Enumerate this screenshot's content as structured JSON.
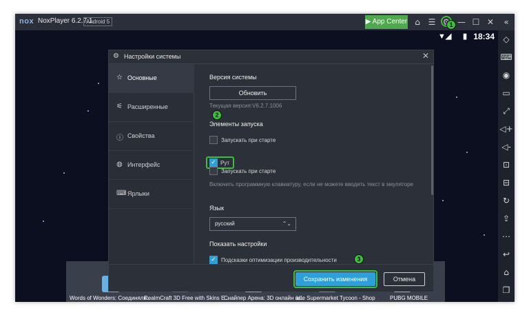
{
  "titlebar": {
    "logo": "nox",
    "app_version": "NoxPlayer 6.2.7.1",
    "android_badge": "Android 5",
    "app_center_label": "App Center"
  },
  "status": {
    "time": "18:34"
  },
  "dialog": {
    "title": "Настройки системы",
    "nav": [
      {
        "label": "Основные",
        "icon": "star-icon"
      },
      {
        "label": "Расширенные",
        "icon": "sliders-icon"
      },
      {
        "label": "Свойства",
        "icon": "info-icon"
      },
      {
        "label": "Интерфейс",
        "icon": "palette-icon"
      },
      {
        "label": "Ярлыки",
        "icon": "keyboard-icon"
      }
    ],
    "content": {
      "system_version_heading": "Версия системы",
      "update_button": "Обновить",
      "current_version": "Текущая версия:V6.2.7.1006",
      "startup_heading": "Элементы запуска",
      "checkbox_startup": "Запускать при старте",
      "checkbox_root": "Рут",
      "checkbox_startup2": "Запускать при старте",
      "keyboard_note": "Включить программную клавиатуру, если не можете вводить текст в эмуляторе",
      "language_heading": "Язык",
      "language_value": "русский",
      "show_settings_heading": "Показать настройки",
      "checkbox_hints": "Подсказки оптимизации производительности"
    },
    "save_button": "Сохранить изменения",
    "cancel_button": "Отмена"
  },
  "badges": {
    "one": "1",
    "two": "2",
    "three": "3"
  },
  "apps": [
    "Words of Wonders: Соединялк...",
    "RealmCraft 3D Free with Skins E...",
    "Снайпер Арена: 3D онлайн ш...",
    "Idle Supermarket Tycoon - Shop",
    "PUBG MOBILE"
  ],
  "colors": {
    "accent": "#2e9fd8",
    "highlight": "#3fbd3f",
    "app_center": "#4fa84d"
  }
}
